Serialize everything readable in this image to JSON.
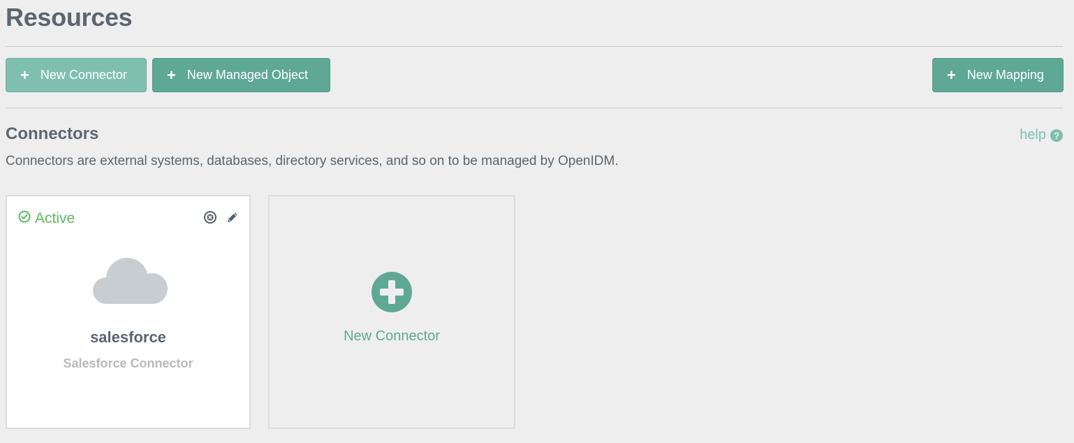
{
  "page": {
    "title": "Resources"
  },
  "toolbar": {
    "new_connector_label": "New Connector",
    "new_managed_object_label": "New Managed Object",
    "new_mapping_label": "New Mapping",
    "plus_glyph": "+"
  },
  "connectors_section": {
    "title": "Connectors",
    "help_label": "help",
    "help_glyph": "?",
    "description": "Connectors are external systems, databases, directory services, and so on to be managed by OpenIDM."
  },
  "connector_cards": [
    {
      "status": "Active",
      "name": "salesforce",
      "type": "Salesforce Connector",
      "icon": "cloud-icon"
    }
  ],
  "new_connector_card": {
    "label": "New Connector",
    "icon": "plus-circle-icon"
  },
  "colors": {
    "accent": "#5fa894",
    "accent_light": "#7fbfae",
    "active_status": "#5cb85c",
    "cloud": "#c8cdd1"
  }
}
